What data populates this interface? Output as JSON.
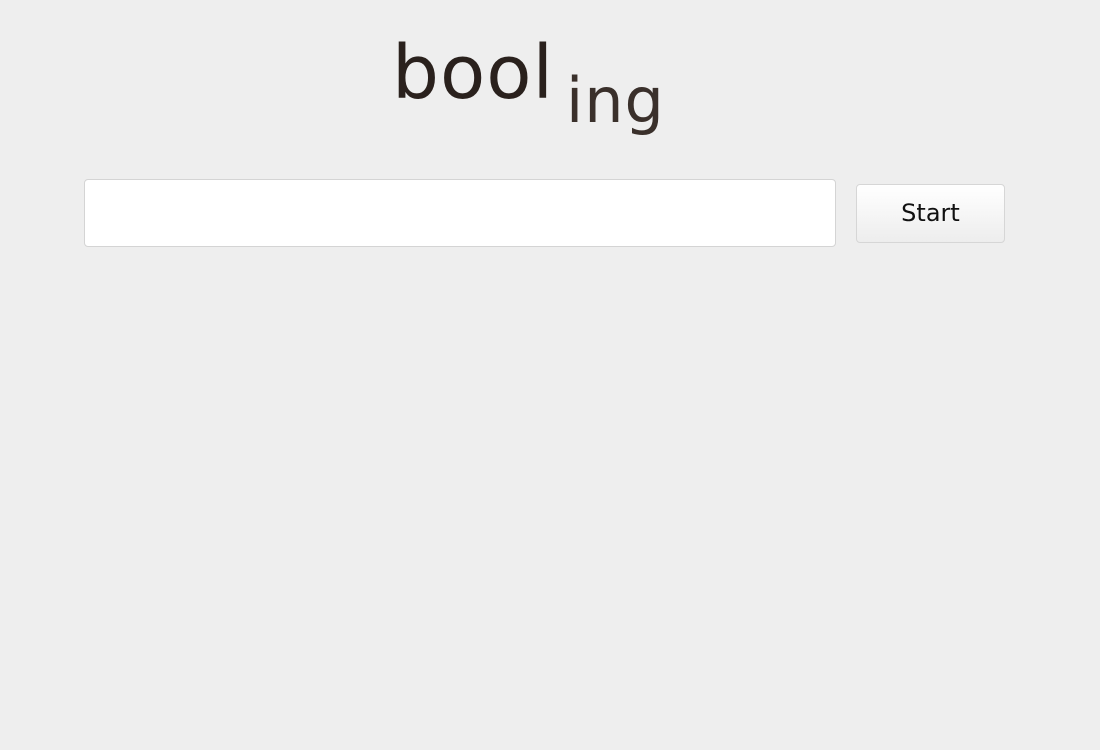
{
  "logo": {
    "main": "bool",
    "suffix": "ing"
  },
  "search": {
    "value": "",
    "placeholder": ""
  },
  "start_button": {
    "label": "Start"
  },
  "colors": {
    "background": "#eeeeee",
    "logo_text": "#2a211d",
    "input_background": "#ffffff"
  }
}
